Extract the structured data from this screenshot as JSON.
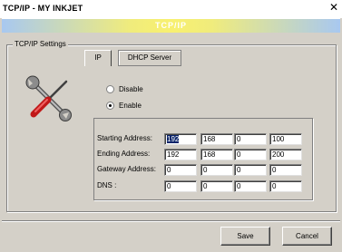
{
  "window": {
    "title": "TCP/IP - MY INKJET",
    "close_glyph": "✕"
  },
  "banner": {
    "text": "TCP/IP"
  },
  "settings": {
    "group_label": "TCP/IP Settings",
    "tabs": [
      {
        "label": "IP",
        "active": false
      },
      {
        "label": "DHCP Server",
        "active": true
      }
    ],
    "icon": "wrench-screwdriver-icon",
    "dhcp_mode": {
      "options": [
        {
          "label": "Disable",
          "checked": false
        },
        {
          "label": "Enable",
          "checked": true
        }
      ]
    },
    "addresses": [
      {
        "label": "Starting Address:",
        "octets": [
          "192",
          "168",
          "0",
          "100"
        ]
      },
      {
        "label": "Ending Address:",
        "octets": [
          "192",
          "168",
          "0",
          "200"
        ]
      },
      {
        "label": "Gateway Address:",
        "octets": [
          "0",
          "0",
          "0",
          "0"
        ]
      },
      {
        "label": "DNS :",
        "octets": [
          "0",
          "0",
          "0",
          "0"
        ]
      }
    ]
  },
  "buttons": {
    "save": "Save",
    "cancel": "Cancel"
  },
  "colors": {
    "face": "#d4d0c8",
    "selection": "#0a246a",
    "banner_center": "#f8f070",
    "banner_edge": "#a8c8f0"
  }
}
